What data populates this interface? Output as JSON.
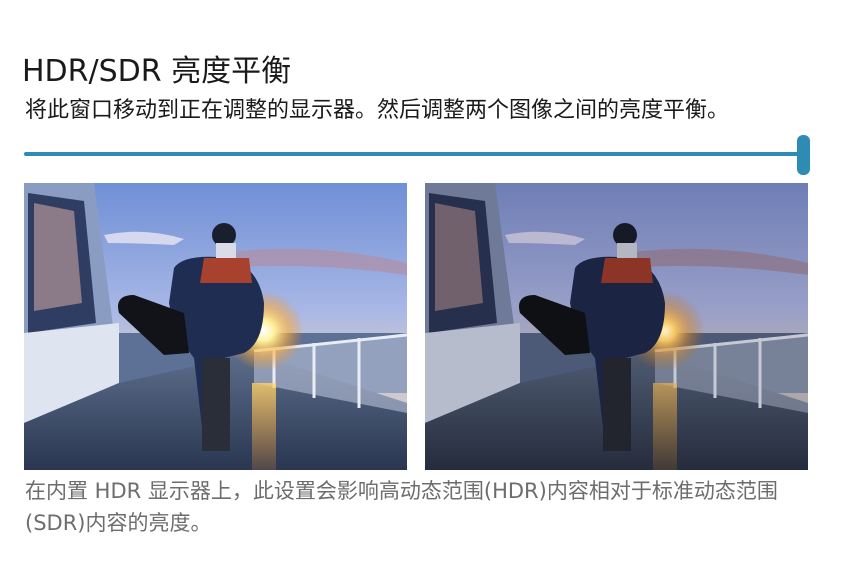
{
  "header": {
    "title": "HDR/SDR 亮度平衡",
    "instruction": "将此窗口移动到正在调整的显示器。然后调整两个图像之间的亮度平衡。"
  },
  "slider": {
    "value_fraction": 1.0,
    "color": "#2e8bb4"
  },
  "images": {
    "hdr_image": "hdr-sample-photo",
    "sdr_image": "sdr-sample-photo"
  },
  "footer": {
    "description": "在内置 HDR 显示器上，此设置会影响高动态范围(HDR)内容相对于标准动态范围(SDR)内容的亮度。"
  }
}
